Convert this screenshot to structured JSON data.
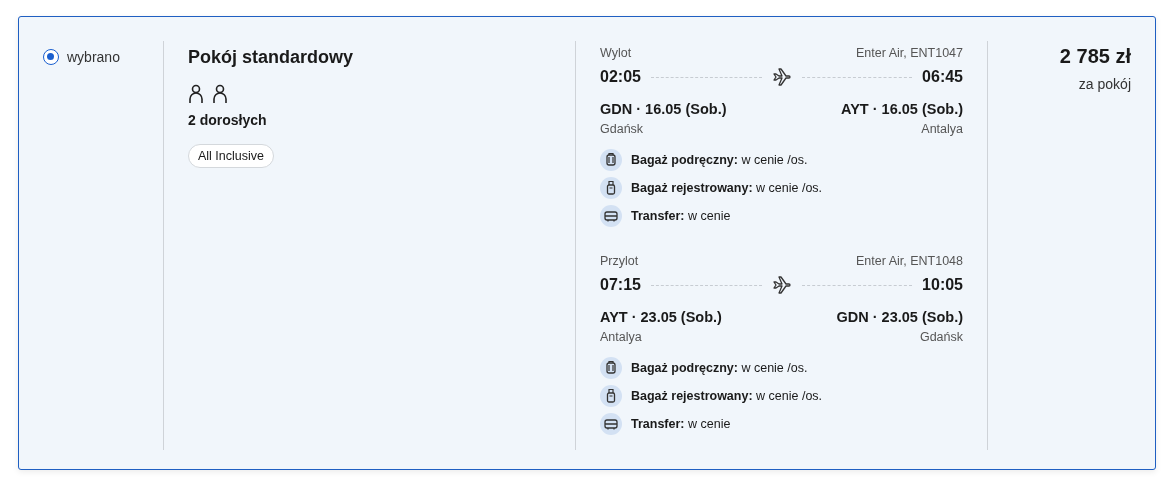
{
  "option": {
    "label": "wybrano",
    "selected": true
  },
  "room": {
    "title": "Pokój standardowy",
    "people": [
      {
        "kind": "adult"
      },
      {
        "kind": "adult"
      }
    ],
    "guests": "2 dorosłych",
    "board": "All Inclusive"
  },
  "flights": [
    {
      "label": "Wylot",
      "airline": "Enter Air, ENT1047",
      "departure_time": "02:05",
      "arrival_time": "06:45",
      "departure": "GDN · 16.05 (Sob.)",
      "arrival": "AYT · 16.05 (Sob.)",
      "departure_city": "Gdańsk",
      "arrival_city": "Antalya",
      "amenities": [
        {
          "kind": "hand-luggage",
          "text": "**Bagaż podręczny:** w cenie /os."
        },
        {
          "kind": "checked-luggage",
          "text": "**Bagaż rejestrowany:** w cenie /os."
        },
        {
          "kind": "transfer",
          "text": "**Transfer:** w cenie"
        }
      ]
    },
    {
      "label": "Przylot",
      "airline": "Enter Air, ENT1048",
      "departure_time": "07:15",
      "arrival_time": "10:05",
      "departure": "AYT · 23.05 (Sob.)",
      "arrival": "GDN · 23.05 (Sob.)",
      "departure_city": "Antalya",
      "arrival_city": "Gdańsk",
      "amenities": [
        {
          "kind": "hand-luggage",
          "text": "**Bagaż podręczny:** w cenie /os."
        },
        {
          "kind": "checked-luggage",
          "text": "**Bagaż rejestrowany:** w cenie /os."
        },
        {
          "kind": "transfer",
          "text": "**Transfer:** w cenie"
        }
      ]
    }
  ],
  "price": {
    "amount": "2 785 zł",
    "note": "za pokój"
  }
}
